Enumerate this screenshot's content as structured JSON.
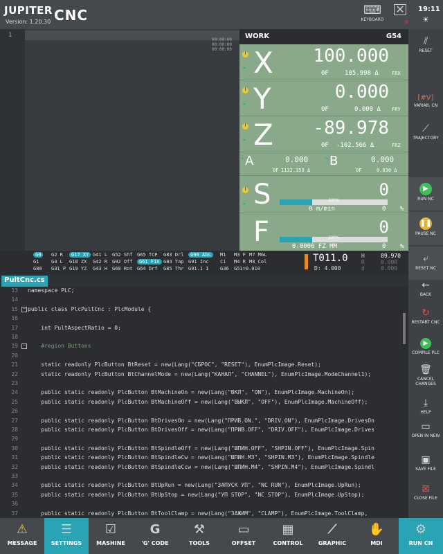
{
  "header": {
    "brand_left": "JUPITER",
    "brand_right": "CNC",
    "version": "Version:  1.20.30",
    "keyboard": "KEYBOARD",
    "time": "19:11",
    "close_badge": "0"
  },
  "program": {
    "line_number": "1",
    "times": [
      "00:00:00",
      "00:00:00",
      "00:00:00"
    ]
  },
  "work": {
    "title": "WORK",
    "offset": "G54",
    "axes": [
      {
        "name": "X",
        "value": "100.000",
        "f": "0F",
        "sub": "105.998 Δ",
        "unit": "FRX"
      },
      {
        "name": "Y",
        "value": "0.000",
        "f": "0F",
        "sub": "0.000 Δ",
        "unit": "FRY"
      },
      {
        "name": "Z",
        "value": "-89.978",
        "f": "0F",
        "sub": "-102.566 Δ",
        "unit": "FRZ"
      }
    ],
    "small_axes": [
      {
        "name": "A",
        "value": "0.000",
        "f": "0F",
        "sub": "1132.359 Δ"
      },
      {
        "name": "B",
        "value": "0.000",
        "f": "0F",
        "sub": "0.030 Δ"
      }
    ],
    "spindle": {
      "name": "S",
      "value": "0",
      "speed": "0 m/min",
      "right": "0",
      "pct_sign": "%",
      "bar_label": "100%",
      "bar_fraction": 0.3
    },
    "feed": {
      "name": "F",
      "value": "0",
      "speed": "0.0000 FZ MM",
      "right": "0",
      "pct_sign": "%",
      "bar_label": "100%",
      "bar_fraction": 0.3
    }
  },
  "gcodes": [
    [
      "G0",
      "G2 R",
      "G17 XY",
      "G41 L",
      "G52 Shf",
      "G65 TCP",
      "G83 Drl",
      "G90 Abs",
      "M1",
      "M3 F",
      "M7 MGL"
    ],
    [
      "G1",
      "G3 L",
      "G18 ZX",
      "G42 R",
      "G92 Off",
      "G61 Fin",
      "G84 Tap",
      "G91 Inc",
      "Ci",
      "M4 R",
      "M8 Col"
    ],
    [
      "G80",
      "G31 P",
      "G19 YZ",
      "G43 H",
      "G68 Rot",
      "G64 Drf",
      "G85 Thr",
      "G91.1 I",
      "G36",
      "G51=0.010",
      ""
    ]
  ],
  "gcode_highlights": [
    "G0",
    "G17 XY",
    "G90 Abs",
    "G61 Fin"
  ],
  "tool": {
    "name": "T011.0",
    "d": "D: 4.000",
    "h_label": "H",
    "h_value": "89.970",
    "r_label": "R",
    "r_value": "0.000",
    "d_label": "d",
    "d_value": "0.000"
  },
  "right_panel": {
    "reset": "RESET",
    "variab": "VARIAB. CN",
    "variab_icon": "[#V]",
    "trajectory": "TRAJECTORY",
    "run_nc": "RUN NC",
    "pause_nc": "PAUSE NC",
    "reset_nc": "RESET NC",
    "back": "BACK",
    "restart": "RESTART CNC",
    "compile": "COMPILE PLC",
    "cancel": "CANCEL CHANGES",
    "help": "HELP",
    "open": "OPEN IN NEW",
    "save": "SAVE FILE",
    "close": "CLOSE FILE"
  },
  "editor": {
    "tab": "PultCnc.cs",
    "lines": [
      {
        "n": "13",
        "t": "namespace PLC;"
      },
      {
        "n": "14",
        "t": ""
      },
      {
        "n": "15",
        "t": "public class PlcPultCnc : PlcModule {"
      },
      {
        "n": "16",
        "t": ""
      },
      {
        "n": "17",
        "t": "    int PultAspectRatio = 0;"
      },
      {
        "n": "18",
        "t": ""
      },
      {
        "n": "19",
        "t": "    #region Buttons"
      },
      {
        "n": "20",
        "t": ""
      },
      {
        "n": "21",
        "t": "    static readonly PlcButton BtReset = new(Lang(\"СБРОС\", \"RESET\"), EnumPlcImage.Reset);"
      },
      {
        "n": "22",
        "t": "    static readonly PlcButton BtChannelMode = new(Lang(\"КАНАЛ\", \"CHANNEL\"), EnumPlcImage.ModeChannel1);"
      },
      {
        "n": "23",
        "t": ""
      },
      {
        "n": "24",
        "t": "    public static readonly PlcButton BtMachineOn = new(Lang(\"ВКЛ\", \"ON\"), EnumPlcImage.MachineOn);"
      },
      {
        "n": "25",
        "t": "    public static readonly PlcButton BtMachineOff = new(Lang(\"ВЫКЛ\", \"OFF\"), EnumPlcImage.MachineOff);"
      },
      {
        "n": "26",
        "t": ""
      },
      {
        "n": "27",
        "t": "    public static readonly PlcButton BtDrivesOn = new(Lang(\"ПРИВ.ON.\", \"DRIV.ON\"), EnumPlcImage.DrivesOn"
      },
      {
        "n": "28",
        "t": "    public static readonly PlcButton BtDrivesOff = new(Lang(\"ПРИВ.OFF\", \"DRIV.OFF\"), EnumPlcImage.Drives"
      },
      {
        "n": "29",
        "t": ""
      },
      {
        "n": "30",
        "t": "    public static readonly PlcButton BtSpindleOff = new(Lang(\"ШПИН.OFF\", \"SHPIN.OFF\"), EnumPlcImage.Spin"
      },
      {
        "n": "31",
        "t": "    public static readonly PlcButton BtSpindleCw = new(Lang(\"ШПИН.M3\", \"SHPIN.M3\"), EnumPlcImage.Spindle"
      },
      {
        "n": "32",
        "t": "    public static readonly PlcButton BtSpindleCcw = new(Lang(\"ШПИН.M4\", \"SHPIN.M4\"), EnumPlcImage.Spindl"
      },
      {
        "n": "33",
        "t": ""
      },
      {
        "n": "34",
        "t": "    public static readonly PlcButton BtUpRun = new(Lang(\"ЗАПУСК УП\", \"NC RUN\"), EnumPlcImage.UpRun);"
      },
      {
        "n": "35",
        "t": "    public static readonly PlcButton BtUpStop = new(Lang(\"УП STOP\", \"NC STOP\"), EnumPlcImage.UpStop);"
      },
      {
        "n": "36",
        "t": ""
      },
      {
        "n": "37",
        "t": "    public static readonly PlcButton BtToolClamp = new(Lang(\"ЗАЖИМ\", \"CLAMP\"), EnumPlcImage.ToolClamp, "
      }
    ]
  },
  "bottom_nav": [
    {
      "label": "MESSAGE",
      "icon": "warning-icon"
    },
    {
      "label": "SETTINGS",
      "icon": "sliders-icon"
    },
    {
      "label": "MASHINE",
      "icon": "checklist-icon"
    },
    {
      "label": "'G' CODE",
      "icon": "gcode-icon"
    },
    {
      "label": "TOOLS",
      "icon": "tools-icon"
    },
    {
      "label": "OFFSET",
      "icon": "offset-icon"
    },
    {
      "label": "CONTROL",
      "icon": "control-icon"
    },
    {
      "label": "GRAPHIC",
      "icon": "graphic-icon"
    },
    {
      "label": "MDI",
      "icon": "hand-icon"
    },
    {
      "label": "RUN CN",
      "icon": "run-icon"
    }
  ],
  "colors": {
    "accent": "#2aa3b4",
    "work_bg": "#8aa98a",
    "warning": "#e8c93a",
    "run_green": "#3fbf5a"
  }
}
